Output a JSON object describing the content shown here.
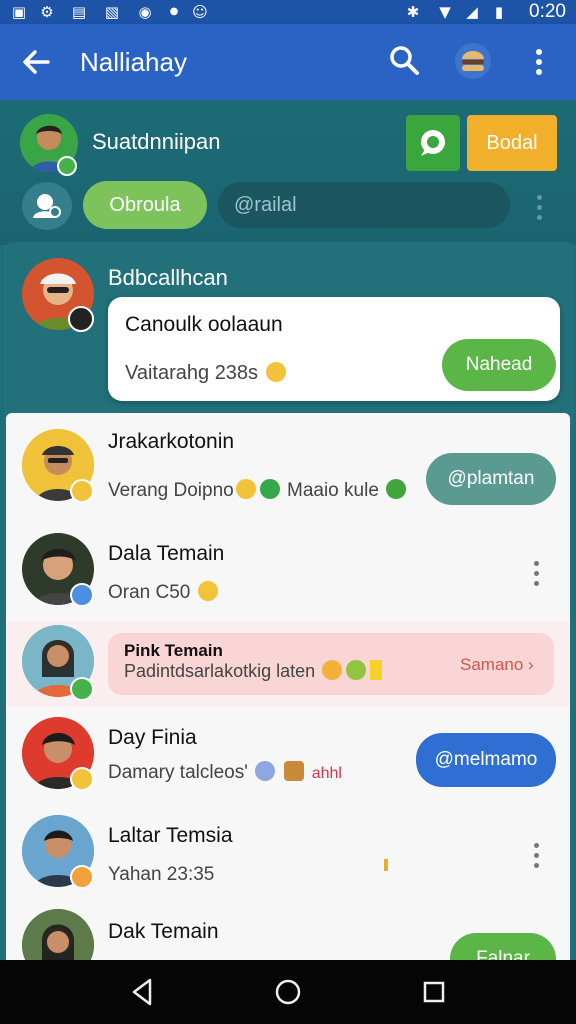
{
  "status_bar": {
    "time": "0:20",
    "icons": [
      "notification-icon",
      "settings-icon",
      "message-icon",
      "app-icon",
      "game-icon",
      "dot-icon",
      "emoji-icon",
      "vibrate-icon",
      "wifi-icon",
      "signal-icon",
      "battery-icon"
    ]
  },
  "app_bar": {
    "title": "Nalliahay",
    "back_icon": "arrow-back-icon",
    "search_icon": "search-icon",
    "menu_icon": "more-vert-icon",
    "accent": "#2a63c4"
  },
  "profile": {
    "name": "Suatdnniipan",
    "chat_button_icon": "chat-bubble-icon",
    "orange_button_label": "Bodal",
    "filter_button_label": "Obroula",
    "search_placeholder": "@railal"
  },
  "featured": {
    "name": "Bdbcallhcan",
    "bubble_title": "Canoulk oolaaun",
    "bubble_subtitle": "Vaitarahg 238s",
    "action_label": "Nahead"
  },
  "chats": [
    {
      "name": "Jrakarkotonin",
      "subtitle": "Verang Doipno",
      "subtitle_suffix": "Maaio kule",
      "action_label": "@plamtan"
    },
    {
      "name": "Dala Temain",
      "subtitle": "Oran C50"
    },
    {
      "name": "Pink Temain",
      "subtitle": "Padintdsarlakotkig laten",
      "action_label": "Samano ›"
    },
    {
      "name": "Day Finia",
      "subtitle": "Damary talcleos'",
      "extra_text": "ahhl",
      "action_label": "@melmamo"
    },
    {
      "name": "Laltar Temsia",
      "subtitle": "Yahan 23:35"
    },
    {
      "name": "Dak Temain",
      "action_label": "Falnar"
    }
  ],
  "nav_bar": {
    "back_icon": "nav-back-icon",
    "home_icon": "nav-home-icon",
    "recents_icon": "nav-recents-icon"
  }
}
